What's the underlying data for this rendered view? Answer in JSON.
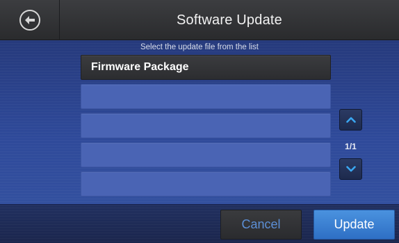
{
  "header": {
    "title": "Software Update",
    "back_icon": "back-arrow-icon"
  },
  "main": {
    "instruction": "Select the update file from the list",
    "list": {
      "items": [
        {
          "label": "Firmware Package",
          "selected": true
        },
        {
          "label": "",
          "selected": false
        },
        {
          "label": "",
          "selected": false
        },
        {
          "label": "",
          "selected": false
        },
        {
          "label": "",
          "selected": false
        }
      ],
      "page_indicator": "1/1",
      "scroll_up_icon": "chevron-up-icon",
      "scroll_down_icon": "chevron-down-icon"
    }
  },
  "footer": {
    "cancel_label": "Cancel",
    "update_label": "Update"
  },
  "colors": {
    "accent": "#3a86d8",
    "cancel_text": "#5c8fd6",
    "list_item": "#4a64b4",
    "chevron": "#3aa6f0"
  }
}
